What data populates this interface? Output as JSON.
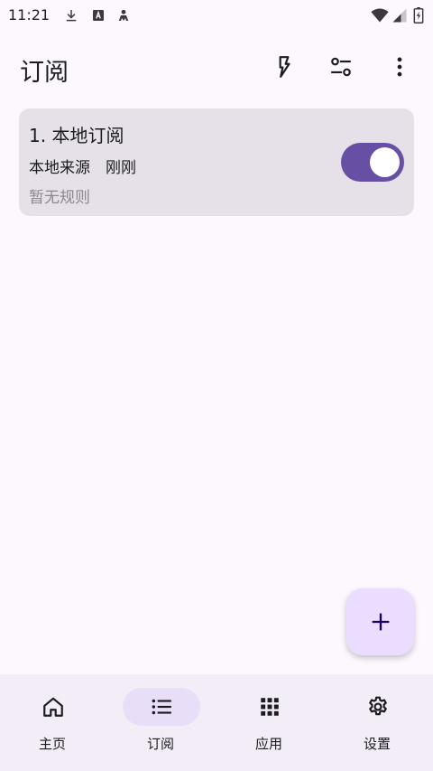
{
  "status_bar": {
    "time": "11:21",
    "icons": [
      "download-icon",
      "font-icon",
      "person-icon",
      "wifi-icon",
      "signal-icon",
      "battery-icon"
    ]
  },
  "app_bar": {
    "title": "订阅",
    "actions": [
      "flash-icon",
      "filter-icon",
      "more-vert-icon"
    ]
  },
  "subscriptions": [
    {
      "title": "1. 本地订阅",
      "source": "本地来源",
      "updated": "刚刚",
      "rules": "暂无规则",
      "enabled": true
    }
  ],
  "fab": {
    "icon": "add-icon"
  },
  "bottom_nav": {
    "items": [
      {
        "label": "主页",
        "icon": "home-icon",
        "active": false
      },
      {
        "label": "订阅",
        "icon": "list-icon",
        "active": true
      },
      {
        "label": "应用",
        "icon": "apps-grid-icon",
        "active": false
      },
      {
        "label": "设置",
        "icon": "settings-gear-icon",
        "active": false
      }
    ]
  },
  "colors": {
    "background": "#fdf7fe",
    "card": "#e6e0e9",
    "accent": "#6750a4",
    "fab": "#eaddff",
    "nav_bar": "#f3edf7",
    "nav_active_pill": "#e8def8"
  }
}
